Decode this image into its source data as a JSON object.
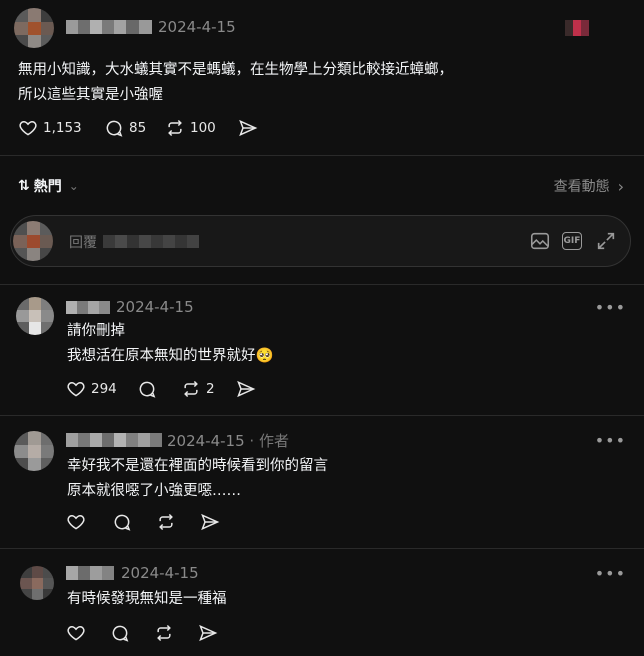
{
  "post": {
    "date": "2024-4-15",
    "lines": [
      "無用小知識，大水蟻其實不是螞蟻，在生物學上分類比較接近蟑螂，",
      "所以這些其實是小強喔"
    ],
    "likes": "1,153",
    "comments": "85",
    "reposts": "100"
  },
  "sort": {
    "label": "熱門",
    "arrow_icon": "sort-arrows-icon",
    "chevron": "⌄"
  },
  "activity": {
    "label": "查看動態",
    "chevron": "›"
  },
  "reply": {
    "placeholder": "回覆",
    "icons": [
      "image-icon",
      "gif-icon",
      "expand-icon"
    ],
    "gif_label": "GIF"
  },
  "comments": [
    {
      "date": "2024-4-15",
      "suffix": "",
      "lines": [
        "請你刪掉",
        "我想活在原本無知的世界就好🥺"
      ],
      "likes": "294",
      "reposts": "2"
    },
    {
      "date": "2024-4-15",
      "suffix": " · 作者",
      "lines": [
        "幸好我不是還在裡面的時候看到你的留言",
        "原本就很噁了小強更噁……"
      ],
      "likes": "",
      "reposts": ""
    },
    {
      "date": "2024-4-15",
      "suffix": "",
      "lines": [
        "有時候發現無知是一種福"
      ],
      "likes": "",
      "reposts": ""
    }
  ],
  "more_label": "•••",
  "colors": {
    "background": "#101010",
    "text": "#f3f5f7",
    "muted": "#8a8a8a",
    "divider": "#2a2a2a"
  }
}
